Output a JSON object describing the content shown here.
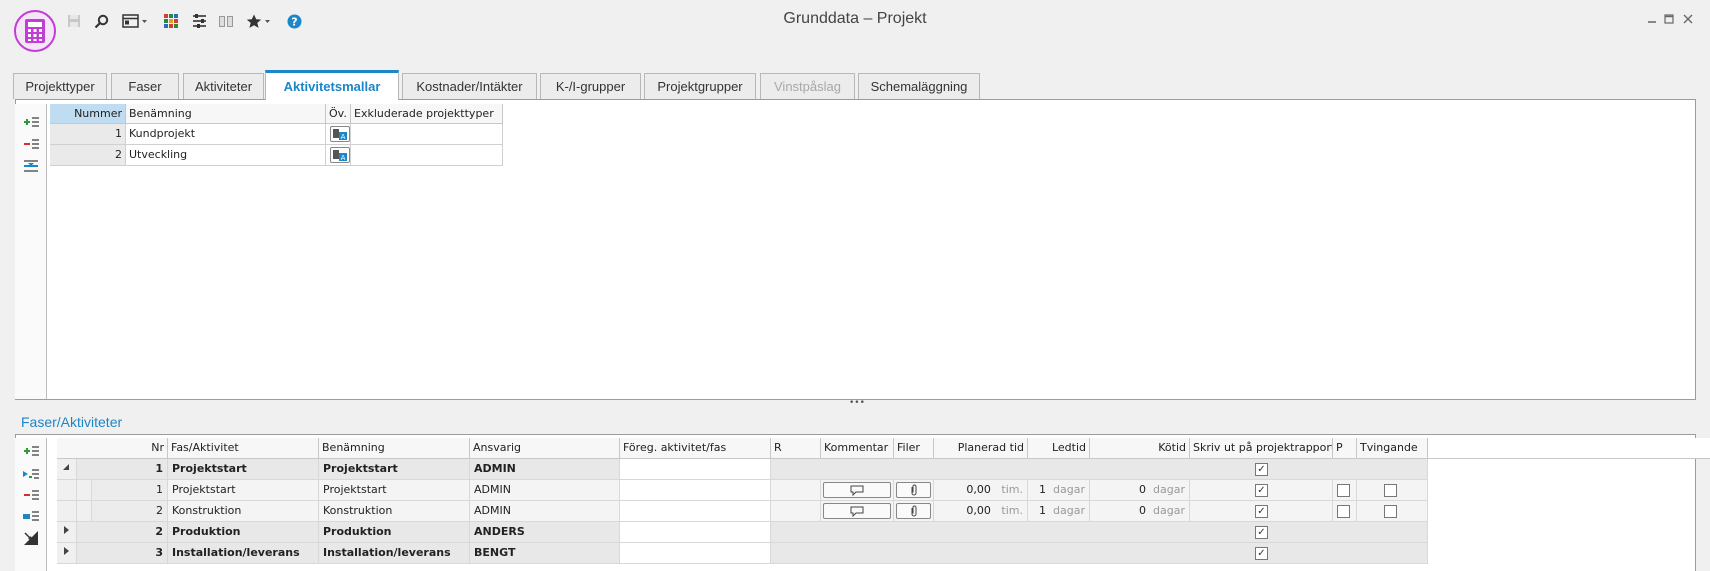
{
  "window": {
    "title": "Grunddata – Projekt"
  },
  "toolbar_icons": [
    "save-icon",
    "search-icon",
    "view-icon",
    "grid-icon",
    "filter-icon",
    "book-icon",
    "star-icon",
    "help-icon"
  ],
  "tabs": [
    {
      "label": "Projekttyper"
    },
    {
      "label": "Faser"
    },
    {
      "label": "Aktiviteter"
    },
    {
      "label": "Aktivitetsmallar",
      "active": true
    },
    {
      "label": "Kostnader/Intäkter"
    },
    {
      "label": "K-/I-grupper"
    },
    {
      "label": "Projektgrupper"
    },
    {
      "label": "Vinstpåslag",
      "disabled": true
    },
    {
      "label": "Schemaläggning"
    }
  ],
  "templates": {
    "columns": {
      "nummer": "Nummer",
      "benamning": "Benämning",
      "ov": "Öv.",
      "exkl": "Exkluderade projekttyper"
    },
    "rows": [
      {
        "nummer": "1",
        "benamning": "Kundprojekt",
        "exkl": ""
      },
      {
        "nummer": "2",
        "benamning": "Utveckling",
        "exkl": ""
      }
    ]
  },
  "phases": {
    "section_title": "Faser/Aktiviteter",
    "columns": {
      "nr": "Nr",
      "fas": "Fas/Aktivitet",
      "benamning": "Benämning",
      "ansvarig": "Ansvarig",
      "foreg": "Föreg. aktivitet/fas",
      "r": "R",
      "kommentar": "Kommentar",
      "filer": "Filer",
      "planerad": "Planerad tid",
      "ledtid": "Ledtid",
      "kotid": "Kötid",
      "skriv": "Skriv ut på projektrapport",
      "p": "P",
      "tvingande": "Tvingande"
    },
    "rows": [
      {
        "level": 0,
        "expanded": true,
        "nr": "1",
        "fas": "Projektstart",
        "benamning": "Projektstart",
        "ansvarig": "ADMIN",
        "skriv": true
      },
      {
        "level": 1,
        "nr": "1",
        "fas": "Projektstart",
        "benamning": "Projektstart",
        "ansvarig": "ADMIN",
        "planerad": "0,00",
        "planerad_unit": "tim.",
        "ledtid": "1",
        "ledtid_unit": "dagar",
        "kotid": "0",
        "kotid_unit": "dagar",
        "skriv": true,
        "p": false,
        "tvingande": false
      },
      {
        "level": 1,
        "nr": "2",
        "fas": "Konstruktion",
        "benamning": "Konstruktion",
        "ansvarig": "ADMIN",
        "planerad": "0,00",
        "planerad_unit": "tim.",
        "ledtid": "1",
        "ledtid_unit": "dagar",
        "kotid": "0",
        "kotid_unit": "dagar",
        "skriv": true,
        "p": false,
        "tvingande": false
      },
      {
        "level": 0,
        "expanded": false,
        "nr": "2",
        "fas": "Produktion",
        "benamning": "Produktion",
        "ansvarig": "ANDERS",
        "skriv": true
      },
      {
        "level": 0,
        "expanded": false,
        "nr": "3",
        "fas": "Installation/leverans",
        "benamning": "Installation/leverans",
        "ansvarig": "BENGT",
        "skriv": true
      }
    ]
  },
  "colors": {
    "accent": "#1b86c8",
    "app_icon": "#c23cd6",
    "selection": "#bfdcf0"
  }
}
